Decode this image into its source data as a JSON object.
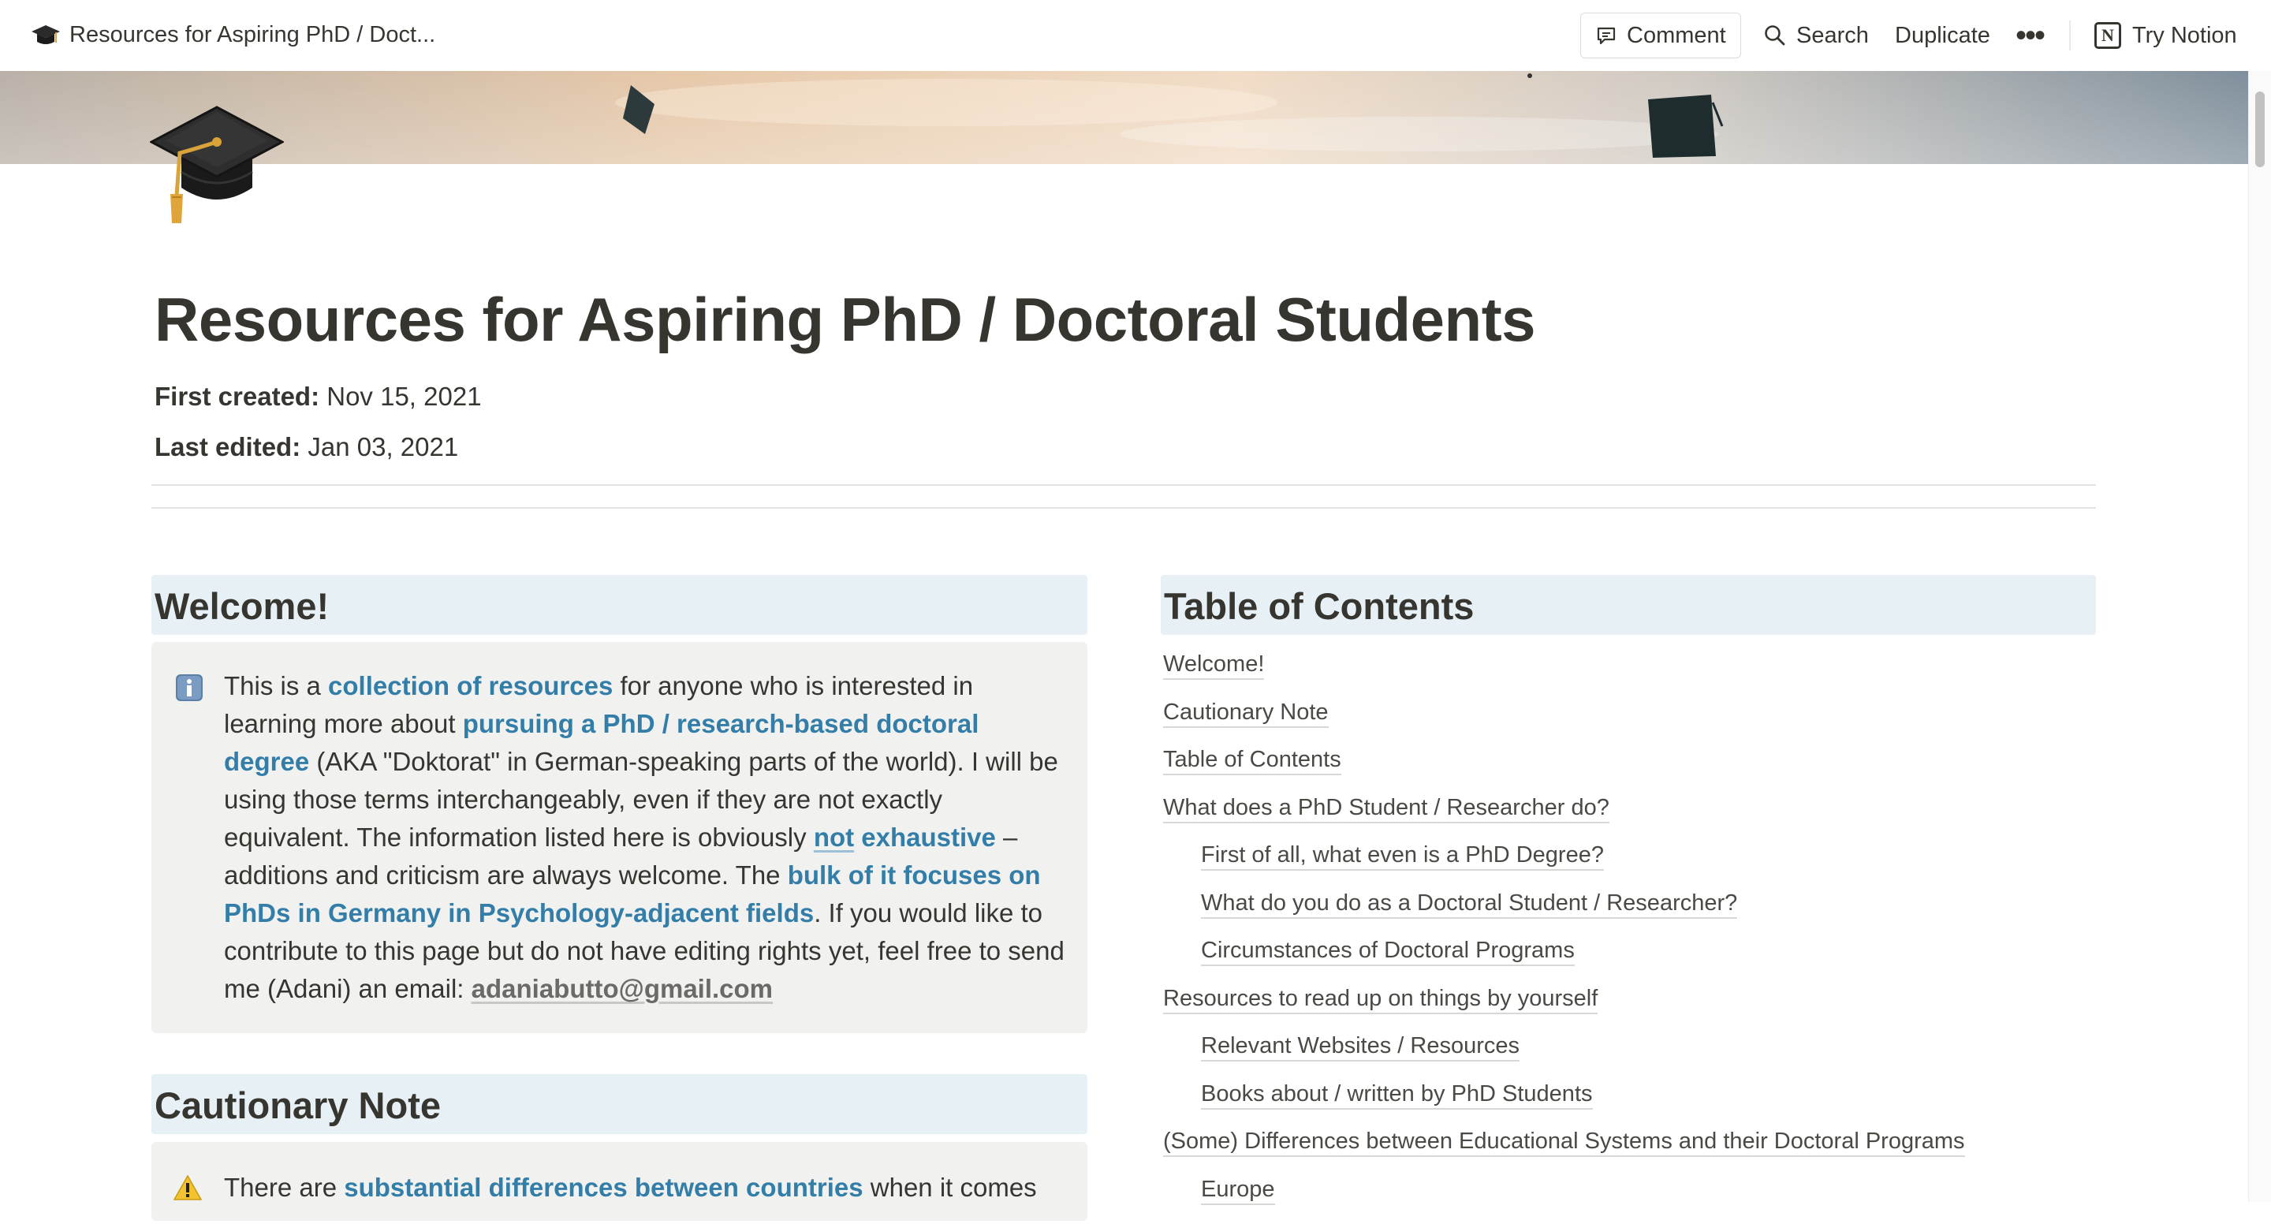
{
  "topbar": {
    "breadcrumb_title": "Resources for Aspiring PhD / Doct...",
    "comment_label": "Comment",
    "search_label": "Search",
    "duplicate_label": "Duplicate",
    "more_label": "•••",
    "try_notion_label": "Try Notion",
    "notion_logo": "N"
  },
  "page": {
    "title": "Resources for Aspiring PhD / Doctoral Students",
    "icon": "graduation-cap-icon",
    "meta": [
      {
        "label": "First created:",
        "value": "Nov 15, 2021"
      },
      {
        "label": "Last edited:",
        "value": "Jan 03, 2021"
      }
    ]
  },
  "welcome": {
    "heading": "Welcome!",
    "icon": "info-icon",
    "t1": "This is a ",
    "l1": "collection of resources",
    "t2": " for anyone who is interested in learning more about ",
    "l2": "pursuing a PhD / research-based doctoral degree",
    "t3": " (AKA \"Doktorat\" in German-speaking parts of the world). I will be using those terms interchangeably, even if they are not exactly equivalent. The information listed here is obviously ",
    "l3a": "not",
    "l3b": " exhaustive",
    "t4": " – additions and criticism are always welcome. The ",
    "l4": "bulk of it focuses on PhDs in Germany in Psychology-adjacent fields",
    "t5": ". If you would like to contribute to this page but do not have editing rights yet, feel free to send me (Adani) an email: ",
    "email": "adaniabutto@gmail.com"
  },
  "caution": {
    "heading": "Cautionary Note",
    "icon": "warning-icon",
    "t1": "There are ",
    "l1": "substantial differences between countries",
    "t2": " when it comes"
  },
  "toc": {
    "heading": "Table of Contents",
    "items": [
      {
        "label": "Welcome!",
        "level": 1
      },
      {
        "label": "Cautionary Note",
        "level": 1
      },
      {
        "label": "Table of Contents",
        "level": 1
      },
      {
        "label": "What does a PhD Student / Researcher do?",
        "level": 1
      },
      {
        "label": "First of all, what even is a PhD Degree?",
        "level": 2
      },
      {
        "label": "What do you do as a Doctoral Student / Researcher?",
        "level": 2
      },
      {
        "label": "Circumstances of Doctoral Programs",
        "level": 2
      },
      {
        "label": "Resources to read up on things by yourself",
        "level": 1
      },
      {
        "label": "Relevant Websites / Resources",
        "level": 2
      },
      {
        "label": "Books about / written by PhD Students",
        "level": 2
      },
      {
        "label": "(Some) Differences between Educational Systems and their Doctoral Programs",
        "level": 1
      },
      {
        "label": "Europe",
        "level": 2
      }
    ]
  },
  "colors": {
    "text": "#37352f",
    "link_blue": "#337ea9",
    "heading_bg": "#e7f0f5",
    "callout_bg": "#f1f1ef"
  }
}
